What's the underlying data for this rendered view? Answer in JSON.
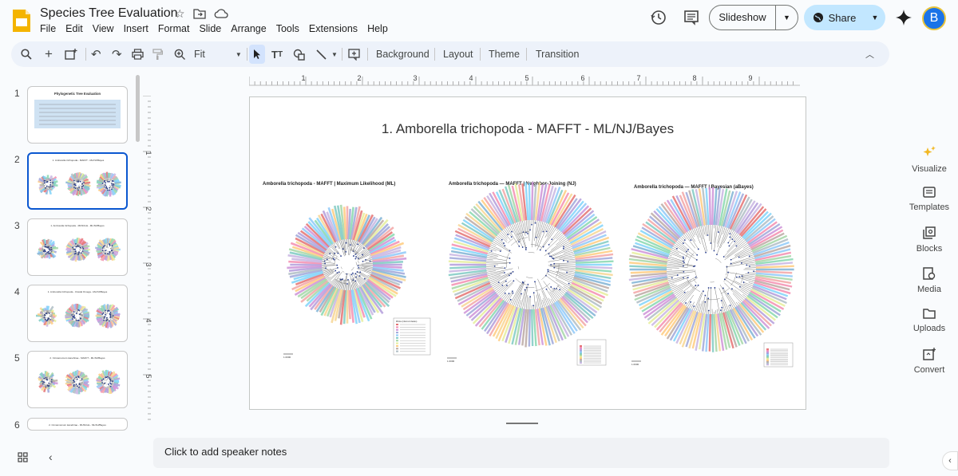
{
  "app": {
    "title": "Species Tree Evaluation",
    "menu": [
      "File",
      "Edit",
      "View",
      "Insert",
      "Format",
      "Slide",
      "Arrange",
      "Tools",
      "Extensions",
      "Help"
    ],
    "slideshow_label": "Slideshow",
    "share_label": "Share",
    "avatar_letter": "B"
  },
  "toolbar": {
    "zoom_label": "Fit",
    "background_label": "Background",
    "layout_label": "Layout",
    "theme_label": "Theme",
    "transition_label": "Transition"
  },
  "ruler": {
    "h_ticks": [
      "1",
      "2",
      "3",
      "4",
      "5",
      "6",
      "7",
      "8",
      "9"
    ],
    "v_ticks": [
      "1",
      "2",
      "3",
      "4",
      "5"
    ]
  },
  "filmstrip": {
    "slides": [
      {
        "num": "1",
        "title": "Phylogenetic Tree Evaluation",
        "kind": "table"
      },
      {
        "num": "2",
        "title": "1. Amborella trichopoda - MAFFT - ML/NJ/Bayes",
        "kind": "trees",
        "selected": true
      },
      {
        "num": "3",
        "title": "1. Amborella trichopoda - MUSCLE - ML/NJ/Bayes",
        "kind": "trees"
      },
      {
        "num": "4",
        "title": "1. Amborella trichopoda - Clustal Omega - ML/NJ/Bayes",
        "kind": "trees"
      },
      {
        "num": "5",
        "title": "2. Cinnamomum kanehirae - MAFFT - ML/NJ/Bayes",
        "kind": "trees"
      },
      {
        "num": "6",
        "title": "2. Cinnamomum kanehirae - MUSCLE - ML/NJ/Bayes",
        "kind": "partial"
      }
    ]
  },
  "slide": {
    "title": "1.   Amborella trichopoda - MAFFT - ML/NJ/Bayes",
    "trees": [
      {
        "label": "Amborella trichopoda - MAFFT | Maximum Likelihood (ML)",
        "scale": "1.0000",
        "legend_title": "MSAs (inferred clades)"
      },
      {
        "label": "Amborella trichopoda — MAFFT | Neighbor-Joining (NJ)",
        "scale": "1.0000",
        "legend_title": ""
      },
      {
        "label": "Amborella trichopoda — MAFFT | Bayesian (aBayes)",
        "scale": "1.0000",
        "legend_title": ""
      }
    ]
  },
  "notes": {
    "placeholder": "Click to add speaker notes"
  },
  "right_panel": {
    "items": [
      {
        "label": "Visualize",
        "icon": "sparkle-icon"
      },
      {
        "label": "Templates",
        "icon": "templates-icon"
      },
      {
        "label": "Blocks",
        "icon": "blocks-icon"
      },
      {
        "label": "Media",
        "icon": "media-icon"
      },
      {
        "label": "Uploads",
        "icon": "folder-icon"
      },
      {
        "label": "Convert",
        "icon": "convert-icon"
      }
    ]
  },
  "colors": {
    "accent": "#0b57d0",
    "share_bg": "#c2e7ff",
    "toolbar_bg": "#edf2fa",
    "palette": [
      "#e57373",
      "#f48fb1",
      "#ce93d8",
      "#9fa8da",
      "#90caf9",
      "#80cbc4",
      "#a5d6a7",
      "#e6ee9c",
      "#ffcc80",
      "#bcaaa4",
      "#b0bec5",
      "#c8b6e2",
      "#f3a6a6",
      "#7fb3d5",
      "#88d8b0",
      "#f7d794",
      "#b39ddb",
      "#81d4fa"
    ]
  }
}
